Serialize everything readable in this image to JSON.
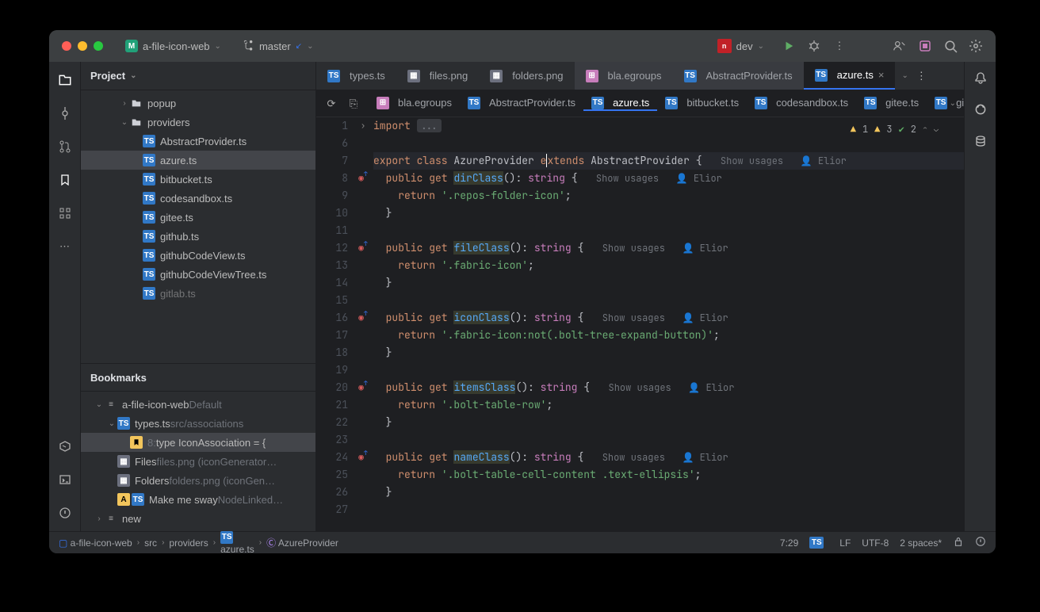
{
  "title": {
    "project": "a-file-icon-web",
    "branch": "master",
    "run_config": "dev"
  },
  "left": {
    "panel_title": "Project",
    "tree": [
      {
        "ind": 3,
        "tw": "›",
        "icon": "folder",
        "label": "popup"
      },
      {
        "ind": 3,
        "tw": "⌄",
        "icon": "folder",
        "label": "providers"
      },
      {
        "ind": 4,
        "icon": "ts",
        "label": "AbstractProvider.ts"
      },
      {
        "ind": 4,
        "icon": "ts",
        "label": "azure.ts",
        "sel": true
      },
      {
        "ind": 4,
        "icon": "ts",
        "label": "bitbucket.ts"
      },
      {
        "ind": 4,
        "icon": "ts",
        "label": "codesandbox.ts"
      },
      {
        "ind": 4,
        "icon": "ts",
        "label": "gitee.ts"
      },
      {
        "ind": 4,
        "icon": "ts",
        "label": "github.ts"
      },
      {
        "ind": 4,
        "icon": "ts",
        "label": "githubCodeView.ts"
      },
      {
        "ind": 4,
        "icon": "ts",
        "label": "githubCodeViewTree.ts"
      },
      {
        "ind": 4,
        "icon": "ts",
        "label": "gitlab.ts",
        "cut": true
      }
    ],
    "bookmarks_title": "Bookmarks",
    "bookmarks": [
      {
        "ind": 1,
        "tw": "⌄",
        "icon": "bm",
        "label": "a-file-icon-web",
        "extra": "Default"
      },
      {
        "ind": 2,
        "tw": "⌄",
        "icon": "ts",
        "label": "types.ts",
        "extra": "src/associations"
      },
      {
        "ind": 3,
        "icon": "bm-y",
        "pre": "8:",
        "label": "type IconAssociation = {",
        "sel": true
      },
      {
        "ind": 2,
        "icon": "png",
        "label": "Files",
        "extra": "files.png  (iconGenerator…"
      },
      {
        "ind": 2,
        "icon": "png",
        "label": "Folders",
        "extra": "folders.png  (iconGen…"
      },
      {
        "ind": 2,
        "icon": "A-ts",
        "label": "Make me sway",
        "extra": "NodeLinked…"
      },
      {
        "ind": 1,
        "tw": "›",
        "icon": "bm",
        "label": "new"
      }
    ]
  },
  "tabs": [
    {
      "icon": "ts",
      "label": "types.ts"
    },
    {
      "icon": "png",
      "label": "files.png"
    },
    {
      "icon": "png",
      "label": "folders.png"
    },
    {
      "icon": "eg",
      "label": "bla.egroups",
      "pinned": true
    },
    {
      "icon": "ts",
      "label": "AbstractProvider.ts",
      "pinned": true
    },
    {
      "icon": "ts",
      "label": "azure.ts",
      "active": true
    }
  ],
  "subtabs": [
    {
      "icon": "eg",
      "label": "bla.egroups"
    },
    {
      "icon": "ts",
      "label": "AbstractProvider.ts"
    },
    {
      "icon": "ts",
      "label": "azure.ts",
      "active": true
    },
    {
      "icon": "ts",
      "label": "bitbucket.ts"
    },
    {
      "icon": "ts",
      "label": "codesandbox.ts"
    },
    {
      "icon": "ts",
      "label": "gitee.ts"
    },
    {
      "icon": "ts",
      "label": "github.t…"
    }
  ],
  "inspections": {
    "err": "1",
    "warn": "3",
    "ok": "2"
  },
  "code_start": 1,
  "code": [
    {
      "n": 1,
      "t": "import",
      "html": "<span class='kw'>import </span><span class='fold'>...</span>"
    },
    {
      "n": 6,
      "html": ""
    },
    {
      "n": 7,
      "cur": true,
      "html": "<span class='kw'>export class</span> <span class='id'>AzureProvider</span> <span class='kw'>e</span><span style='border-left:1px solid #fff'></span><span class='kw'>xtends</span> <span class='id'>AbstractProvider</span> <span class='pn'>{</span>   <span class='hint'>Show usages   👤 Elior</span>"
    },
    {
      "n": 8,
      "gi": "◎",
      "html": "  <span class='kw'>public get</span> <span class='fn hl'>dirClass</span><span class='pn'>():</span> <span class='ty'>string</span> <span class='pn'>{</span>   <span class='hint'>Show usages   👤 Elior</span>"
    },
    {
      "n": 9,
      "html": "    <span class='kw'>return</span> <span class='str'>'.repos-folder-icon'</span><span class='pn'>;</span>"
    },
    {
      "n": 10,
      "html": "  <span class='pn'>}</span>"
    },
    {
      "n": 11,
      "html": ""
    },
    {
      "n": 12,
      "gi": "◎",
      "html": "  <span class='kw'>public get</span> <span class='fn hl'>fileClass</span><span class='pn'>():</span> <span class='ty'>string</span> <span class='pn'>{</span>   <span class='hint'>Show usages   👤 Elior</span>"
    },
    {
      "n": 13,
      "html": "    <span class='kw'>return</span> <span class='str'>'.fabric-icon'</span><span class='pn'>;</span>"
    },
    {
      "n": 14,
      "html": "  <span class='pn'>}</span>"
    },
    {
      "n": 15,
      "html": ""
    },
    {
      "n": 16,
      "gi": "◎",
      "html": "  <span class='kw'>public get</span> <span class='fn hl'>iconClass</span><span class='pn'>():</span> <span class='ty'>string</span> <span class='pn'>{</span>   <span class='hint'>Show usages   👤 Elior</span>"
    },
    {
      "n": 17,
      "html": "    <span class='kw'>return</span> <span class='str'>'.fabric-icon:not(.bolt-tree-expand-button)'</span><span class='pn'>;</span>"
    },
    {
      "n": 18,
      "html": "  <span class='pn'>}</span>"
    },
    {
      "n": 19,
      "html": ""
    },
    {
      "n": 20,
      "gi": "◎",
      "html": "  <span class='kw'>public get</span> <span class='fn hl'>itemsClass</span><span class='pn'>():</span> <span class='ty'>string</span> <span class='pn'>{</span>   <span class='hint'>Show usages   👤 Elior</span>"
    },
    {
      "n": 21,
      "html": "    <span class='kw'>return</span> <span class='str'>'.bolt-table-row'</span><span class='pn'>;</span>"
    },
    {
      "n": 22,
      "html": "  <span class='pn'>}</span>"
    },
    {
      "n": 23,
      "html": ""
    },
    {
      "n": 24,
      "gi": "◎",
      "html": "  <span class='kw'>public get</span> <span class='fn hl'>nameClass</span><span class='pn'>():</span> <span class='ty'>string</span> <span class='pn'>{</span>   <span class='hint'>Show usages   👤 Elior</span>"
    },
    {
      "n": 25,
      "html": "    <span class='kw'>return</span> <span class='str'>'.bolt-table-cell-content .text-ellipsis'</span><span class='pn'>;</span>"
    },
    {
      "n": 26,
      "html": "  <span class='pn'>}</span>"
    },
    {
      "n": 27,
      "html": ""
    }
  ],
  "breadcrumbs": [
    "a-file-icon-web",
    "src",
    "providers",
    "azure.ts",
    "AzureProvider"
  ],
  "status": {
    "pos": "7:29",
    "eol": "LF",
    "enc": "UTF-8",
    "indent": "2 spaces*"
  }
}
